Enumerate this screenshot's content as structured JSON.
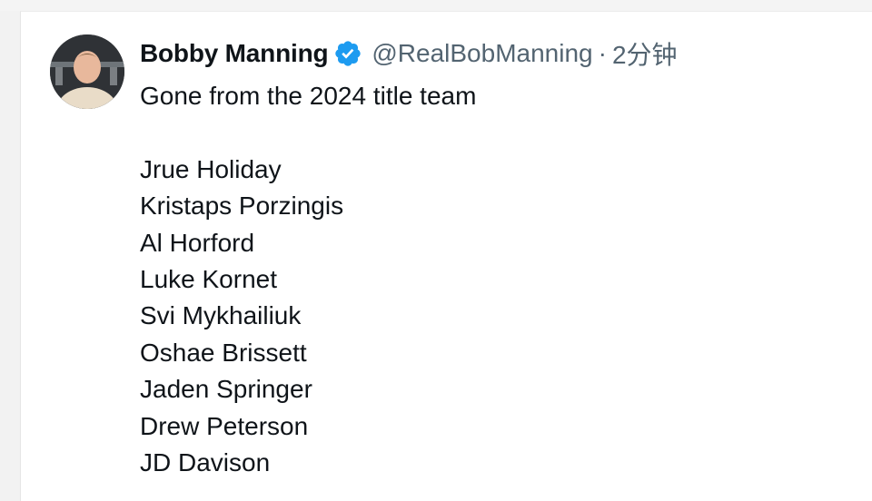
{
  "tweet": {
    "author_name": "Bobby Manning",
    "handle": "@RealBobManning",
    "separator": "·",
    "time": "2分钟",
    "intro": "Gone from the 2024 title team",
    "players": [
      "Jrue Holiday",
      "Kristaps Porzingis",
      "Al Horford",
      "Luke Kornet",
      "Svi Mykhailiuk",
      "Oshae Brissett",
      "Jaden Springer",
      "Drew Peterson",
      "JD Davison"
    ]
  },
  "icons": {
    "verified": "verified-badge-icon",
    "avatar": "avatar"
  },
  "colors": {
    "verified_blue": "#1d9bf0",
    "text_primary": "#0f1419",
    "text_secondary": "#536471"
  }
}
